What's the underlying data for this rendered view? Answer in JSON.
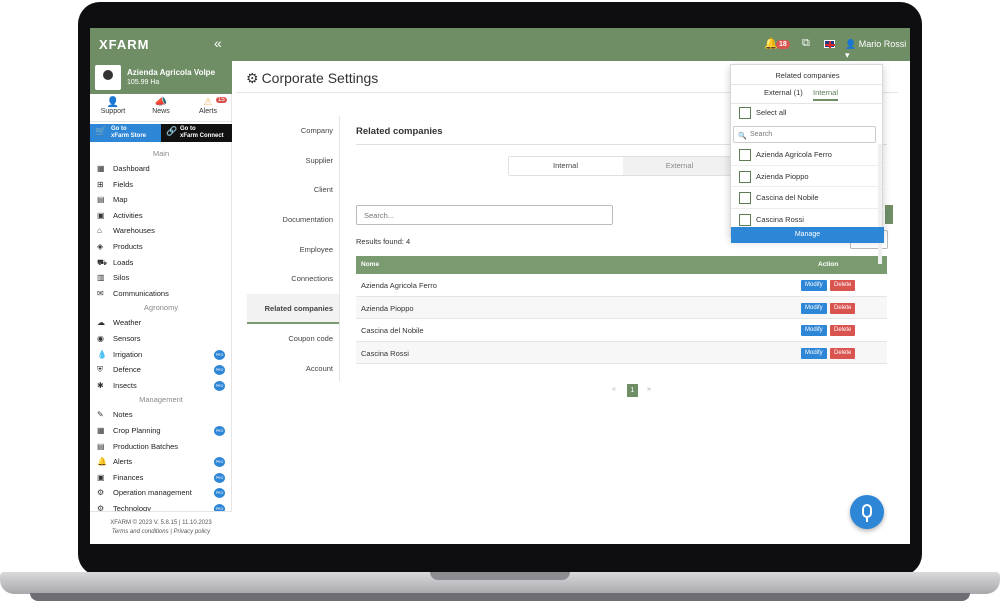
{
  "topbar": {
    "logo": "XFARM",
    "notification_count": "18",
    "user_name": "Mario Rossi"
  },
  "farm": {
    "name": "Azienda Agricola Volpe",
    "area": "105.99 Ha"
  },
  "quick_links": {
    "support": "Support",
    "news": "News",
    "alerts": "Alerts",
    "alerts_badge": "15"
  },
  "store": {
    "store_label_1": "Go to",
    "store_label_2": "xFarm Store",
    "connect_label_1": "Go to",
    "connect_label_2": "xFarm Connect"
  },
  "menu": {
    "main_title": "Main",
    "main": [
      "Dashboard",
      "Fields",
      "Map",
      "Activities",
      "Warehouses",
      "Products",
      "Loads",
      "Silos",
      "Communications"
    ],
    "agronomy_title": "Agronomy",
    "agronomy": [
      "Weather",
      "Sensors",
      "Irrigation",
      "Defence",
      "Insects"
    ],
    "management_title": "Management",
    "management": [
      "Notes",
      "Crop Planning",
      "Production Batches",
      "Alerts",
      "Finances",
      "Operation management",
      "Technology"
    ],
    "pro_label": "PRO"
  },
  "footer": {
    "version": "XFARM © 2023 V. 5.8.15 | 11.10.2023",
    "links": "Terms and conditions | Privacy policy"
  },
  "page": {
    "title": "Corporate Settings",
    "nav": [
      "Company",
      "Supplier",
      "Client",
      "Documentation",
      "Employee",
      "Connections",
      "Related companies",
      "Coupon code",
      "Account"
    ],
    "active_nav": "Related companies"
  },
  "panel": {
    "title": "Related companies",
    "tab_internal": "Internal",
    "tab_external": "External",
    "search_placeholder": "Search...",
    "results": "Results found: 4",
    "col_name": "Nome",
    "col_action": "Action",
    "modify": "Modify",
    "delete": "Delete",
    "rows": [
      "Azienda Agricola Ferro",
      "Azienda Pioppo",
      "Cascina del Nobile",
      "Cascina Rossi"
    ],
    "pager_prev": "«",
    "pager_page": "1",
    "pager_next": "»"
  },
  "dropdown": {
    "title": "Related companies",
    "tab_external": "External (1)",
    "tab_internal": "Internal",
    "select_all": "Select all",
    "search_placeholder": "Search",
    "items": [
      "Azienda Agricola Ferro",
      "Azienda Pioppo",
      "Cascina del Nobile",
      "Cascina Rossi"
    ],
    "manage": "Manage"
  },
  "colors": {
    "brand_green": "#6f8e66",
    "accent_blue": "#2d86d6",
    "danger_red": "#d9534f"
  }
}
